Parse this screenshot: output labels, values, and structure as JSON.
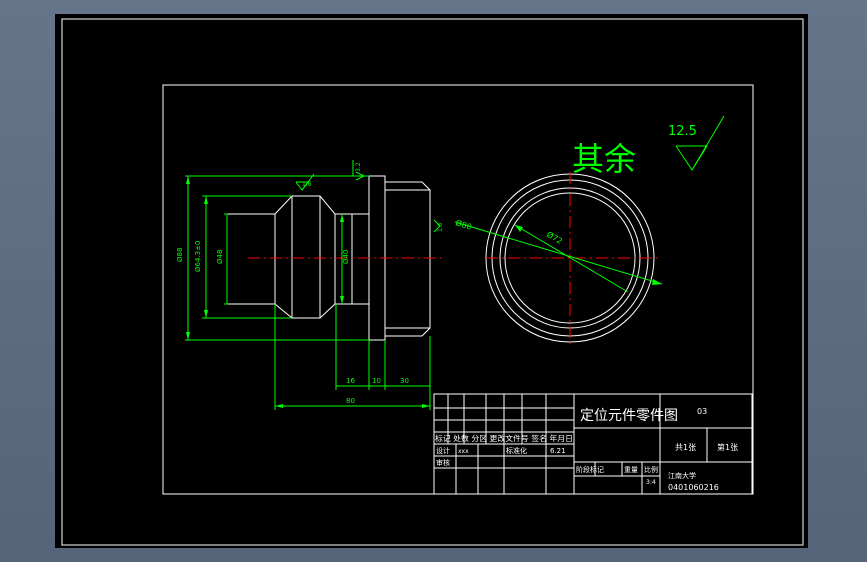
{
  "drawing": {
    "colors": {
      "background": "#000000",
      "border": "#ffffff",
      "geometry": "#ffffff",
      "dimension": "#00ff00",
      "centerline": "#ff0000",
      "viewport": "#5d6b7f"
    },
    "roughness": {
      "label": "其余",
      "value": "12.5"
    },
    "dimensions": {
      "dia_overall": "Ø88",
      "dia_groove": "Ø64.3±0",
      "dia_bore": "Ø48",
      "dia_neck": "Ø40",
      "dia_80": "Ø80",
      "dia_72": "Ø72",
      "len_16": "16",
      "len_10": "10",
      "len_30": "30",
      "len_80": "80",
      "finish_small": "1.6",
      "finish_side": "3.2",
      "finish_right": "1.6"
    },
    "title_block": {
      "part_name": "定位元件零件图",
      "drawing_number": "03",
      "sheets_total": "共1张",
      "sheet_no": "第1张",
      "school": "江南大学",
      "student_id": "0401060216",
      "row_change": "标记 处数 分区 更改文件号 签名 年月日",
      "designer_label": "设计",
      "designer_name": "xxx",
      "standardization": "标准化",
      "date": "6.21",
      "reviewer": "审核",
      "stage_label": "阶段标记",
      "weight_label": "重量",
      "scale_label": "比例",
      "scale_value": "3:4"
    }
  }
}
